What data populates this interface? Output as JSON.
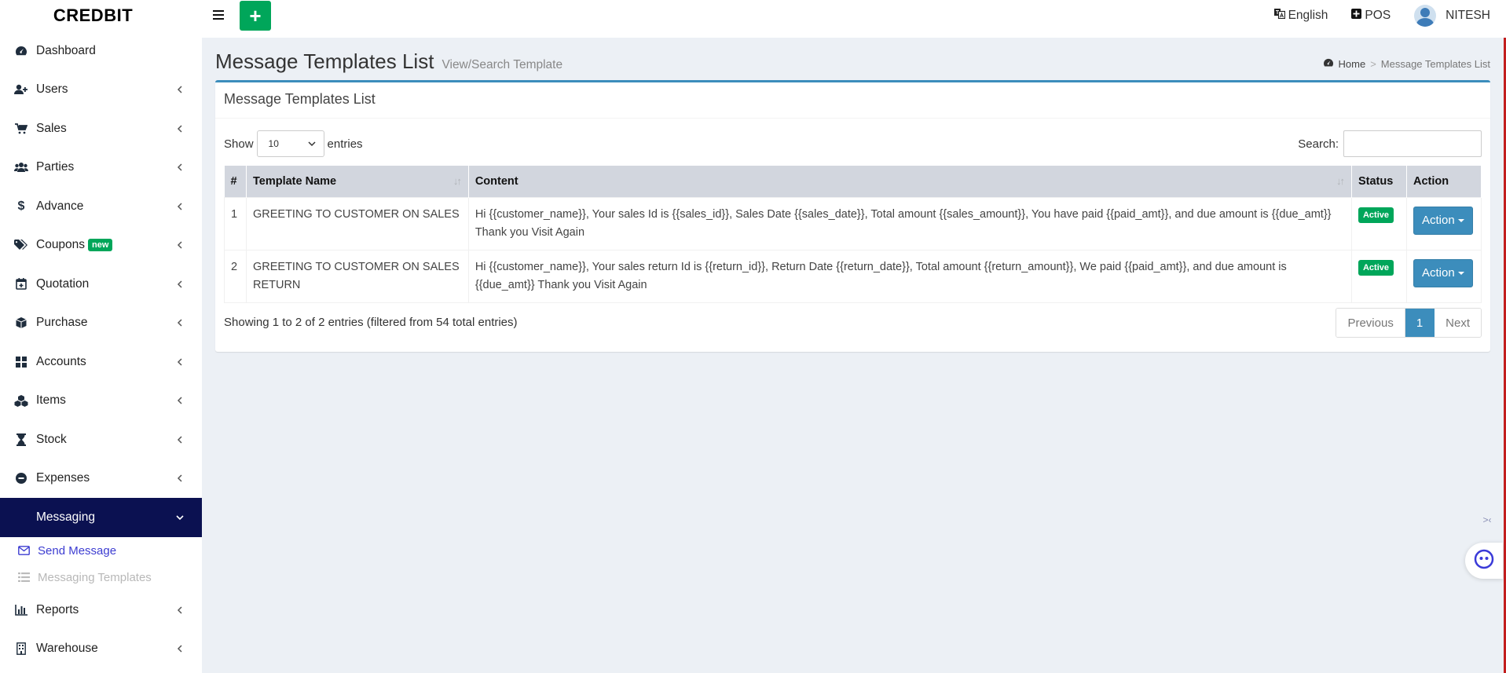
{
  "brand": "CREDBIT",
  "sidebar": {
    "items": [
      {
        "label": "Dashboard",
        "icon": "dashboard-icon"
      },
      {
        "label": "Users",
        "icon": "user-plus-icon"
      },
      {
        "label": "Sales",
        "icon": "cart-icon"
      },
      {
        "label": "Parties",
        "icon": "users-icon"
      },
      {
        "label": "Advance",
        "icon": "dollar-icon"
      },
      {
        "label": "Coupons",
        "icon": "tags-icon",
        "badge": "new"
      },
      {
        "label": "Quotation",
        "icon": "calendar-plus-icon"
      },
      {
        "label": "Purchase",
        "icon": "box-icon"
      },
      {
        "label": "Accounts",
        "icon": "grid-icon"
      },
      {
        "label": "Items",
        "icon": "cubes-icon"
      },
      {
        "label": "Stock",
        "icon": "hourglass-icon"
      },
      {
        "label": "Expenses",
        "icon": "minus-circle-icon"
      },
      {
        "label": "Messaging",
        "icon": "envelope-icon",
        "active": true
      },
      {
        "label": "Reports",
        "icon": "bar-chart-icon"
      },
      {
        "label": "Warehouse",
        "icon": "building-icon"
      }
    ],
    "messaging_sub": [
      {
        "label": "Send Message",
        "icon": "envelope-icon"
      },
      {
        "label": "Messaging Templates",
        "icon": "list-icon"
      }
    ]
  },
  "topbar": {
    "add_label": "+",
    "language": "English",
    "pos": "POS",
    "user": "NITESH"
  },
  "header": {
    "title": "Message Templates List",
    "subtitle": "View/Search Template",
    "breadcrumb": [
      "Home",
      "Message Templates List"
    ]
  },
  "box": {
    "title": "Message Templates List",
    "show_label": "Show",
    "entries_value": "10",
    "entries_label": "entries",
    "search_label": "Search:",
    "search_value": ""
  },
  "table": {
    "columns": [
      "#",
      "Template Name",
      "Content",
      "Status",
      "Action"
    ],
    "rows": [
      {
        "num": "1",
        "name": "GREETING TO CUSTOMER ON SALES",
        "content": "Hi {{customer_name}}, Your sales Id is {{sales_id}}, Sales Date {{sales_date}}, Total amount {{sales_amount}}, You have paid {{paid_amt}}, and due amount is {{due_amt}} Thank you Visit Again",
        "status": "Active",
        "action": "Action"
      },
      {
        "num": "2",
        "name": "GREETING TO CUSTOMER ON SALES RETURN",
        "content": "Hi {{customer_name}}, Your sales return Id is {{return_id}}, Return Date {{return_date}}, Total amount {{return_amount}}, We paid {{paid_amt}}, and due amount is {{due_amt}} Thank you Visit Again",
        "status": "Active",
        "action": "Action"
      }
    ]
  },
  "footer": {
    "info": "Showing 1 to 2 of 2 entries (filtered from 54 total entries)",
    "pagination": [
      "Previous",
      "1",
      "Next"
    ]
  },
  "colors": {
    "sidebar_active": "#0b1151",
    "accent": "#3c8dbc",
    "success": "#00a65a",
    "table_header": "#d2d6de",
    "background": "#ecf0f5"
  }
}
